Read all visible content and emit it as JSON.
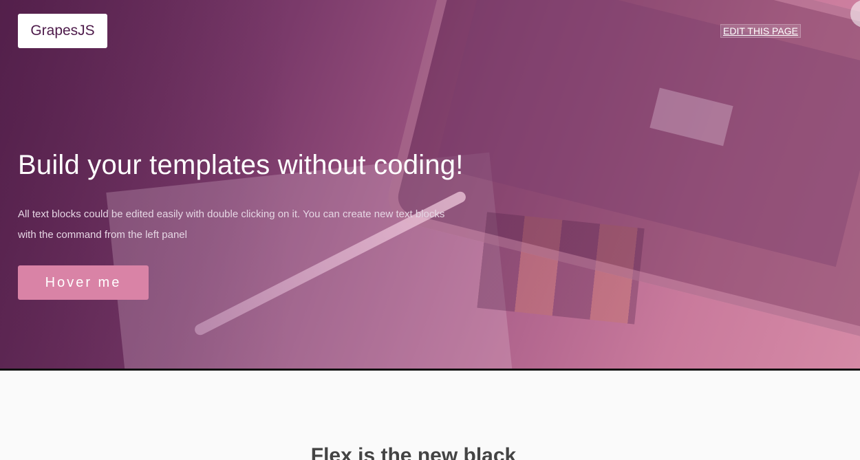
{
  "header": {
    "logo_text": "GrapesJS",
    "edit_link": "EDIT THIS PAGE"
  },
  "hero": {
    "title": "Build your templates without coding!",
    "description": "All text blocks could be edited easily with double clicking on it. You can create new text blocks with the command from the left panel",
    "button_label": "Hover me"
  },
  "section": {
    "title": "Flex is the new black"
  },
  "colors": {
    "button_bg": "#d983a6",
    "logo_text": "#4d1a4a",
    "section_title": "#444444"
  }
}
